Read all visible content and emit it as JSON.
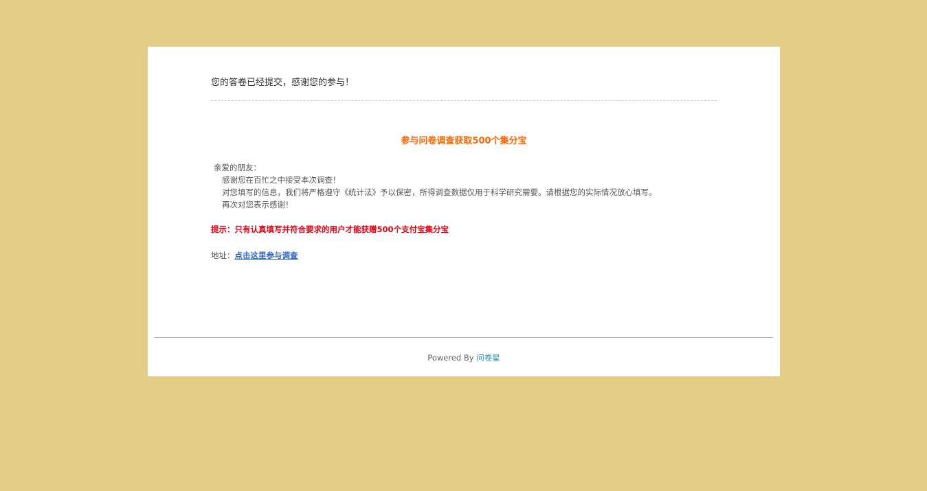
{
  "submission": {
    "message": "您的答卷已经提交，感谢您的参与！"
  },
  "promo": {
    "title": "参与问卷调查获取500个集分宝",
    "greeting": "亲爱的朋友：",
    "paragraphs": [
      "感谢您在百忙之中接受本次调查！",
      "对您填写的信息，我们将严格遵守《统计法》予以保密，所得调查数据仅用于科学研究需要。请根据您的实际情况放心填写。",
      "再次对您表示感谢！"
    ],
    "tip": "提示：只有认真填写并符合要求的用户才能获赠500个支付宝集分宝",
    "address_label": "地址：",
    "address_link": "点击这里参与调查"
  },
  "footer": {
    "powered_by": "Powered By",
    "brand_link": "问卷星"
  },
  "colors": {
    "page_background": "#e4ce87",
    "card_background": "#ffffff",
    "promo_title": "#ff6600",
    "tip_text": "#e60012",
    "link": "#3366cc",
    "brand_link": "#2a8fbd"
  }
}
